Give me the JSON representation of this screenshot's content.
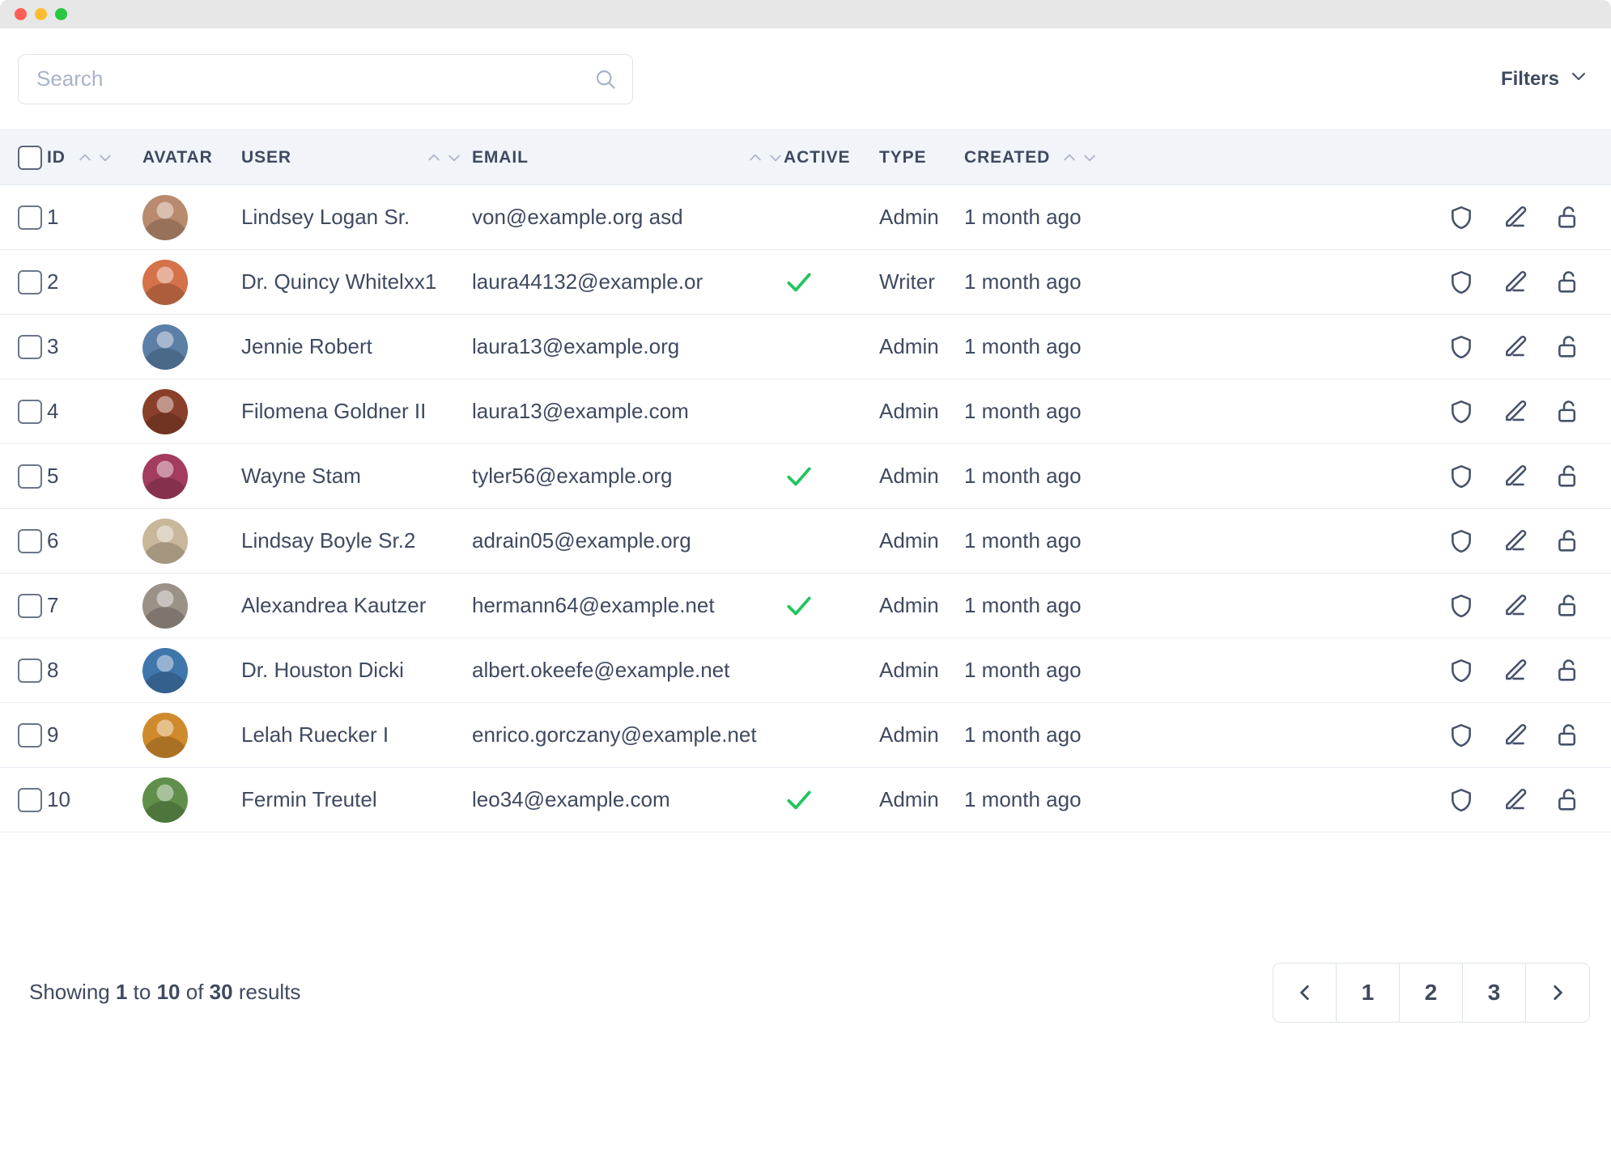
{
  "window": {
    "controls": [
      "close",
      "minimize",
      "maximize"
    ]
  },
  "toolbar": {
    "search_placeholder": "Search",
    "search_value": "",
    "search_icon": "search-icon",
    "filters_label": "Filters",
    "filters_icon": "chevron-down-icon"
  },
  "table": {
    "columns": [
      {
        "key": "check",
        "label": "",
        "sortable": false
      },
      {
        "key": "id",
        "label": "ID",
        "sortable": true
      },
      {
        "key": "avatar",
        "label": "AVATAR",
        "sortable": false
      },
      {
        "key": "user",
        "label": "USER",
        "sortable": true
      },
      {
        "key": "email",
        "label": "EMAIL",
        "sortable": true
      },
      {
        "key": "active",
        "label": "ACTIVE",
        "sortable": false
      },
      {
        "key": "type",
        "label": "TYPE",
        "sortable": false
      },
      {
        "key": "created",
        "label": "CREATED",
        "sortable": true
      },
      {
        "key": "actions",
        "label": "",
        "sortable": false
      }
    ],
    "row_actions": [
      "shield-icon",
      "pencil-icon",
      "unlock-icon"
    ],
    "rows": [
      {
        "id": "1",
        "user": "Lindsey Logan Sr.",
        "email": "von@example.org asd",
        "active": false,
        "type": "Admin",
        "created": "1 month ago",
        "avatar_color": "#b98a6d"
      },
      {
        "id": "2",
        "user": "Dr. Quincy Whitelxx1",
        "email": "laura44132@example.or",
        "active": true,
        "type": "Writer",
        "created": "1 month ago",
        "avatar_color": "#d4724a"
      },
      {
        "id": "3",
        "user": "Jennie Robert",
        "email": "laura13@example.org",
        "active": false,
        "type": "Admin",
        "created": "1 month ago",
        "avatar_color": "#5b7fa6"
      },
      {
        "id": "4",
        "user": "Filomena Goldner II",
        "email": "laura13@example.com",
        "active": false,
        "type": "Admin",
        "created": "1 month ago",
        "avatar_color": "#8a3f2a"
      },
      {
        "id": "5",
        "user": "Wayne Stam",
        "email": "tyler56@example.org",
        "active": true,
        "type": "Admin",
        "created": "1 month ago",
        "avatar_color": "#a33c5e"
      },
      {
        "id": "6",
        "user": "Lindsay Boyle Sr.2",
        "email": "adrain05@example.org",
        "active": false,
        "type": "Admin",
        "created": "1 month ago",
        "avatar_color": "#c9b79b"
      },
      {
        "id": "7",
        "user": "Alexandrea Kautzer",
        "email": "hermann64@example.net",
        "active": true,
        "type": "Admin",
        "created": "1 month ago",
        "avatar_color": "#9a9187"
      },
      {
        "id": "8",
        "user": "Dr. Houston Dicki",
        "email": "albert.okeefe@example.net",
        "active": false,
        "type": "Admin",
        "created": "1 month ago",
        "avatar_color": "#3f76ab"
      },
      {
        "id": "9",
        "user": "Lelah Ruecker I",
        "email": "enrico.gorczany@example.net",
        "active": false,
        "type": "Admin",
        "created": "1 month ago",
        "avatar_color": "#d08a2e"
      },
      {
        "id": "10",
        "user": "Fermin Treutel",
        "email": "leo34@example.com",
        "active": true,
        "type": "Admin",
        "created": "1 month ago",
        "avatar_color": "#5f8f4a"
      }
    ]
  },
  "footer": {
    "showing_prefix": "Showing",
    "from": "1",
    "to_word": "to",
    "to": "10",
    "of_word": "of",
    "total": "30",
    "results_word": "results",
    "pagination": {
      "prev_icon": "chevron-left-icon",
      "next_icon": "chevron-right-icon",
      "pages": [
        "1",
        "2",
        "3"
      ],
      "current": "1"
    }
  },
  "colors": {
    "accent_check": "#22c55e",
    "text": "#3f4a60",
    "header_bg": "#f1f5f9",
    "border": "#e7ecf3"
  }
}
